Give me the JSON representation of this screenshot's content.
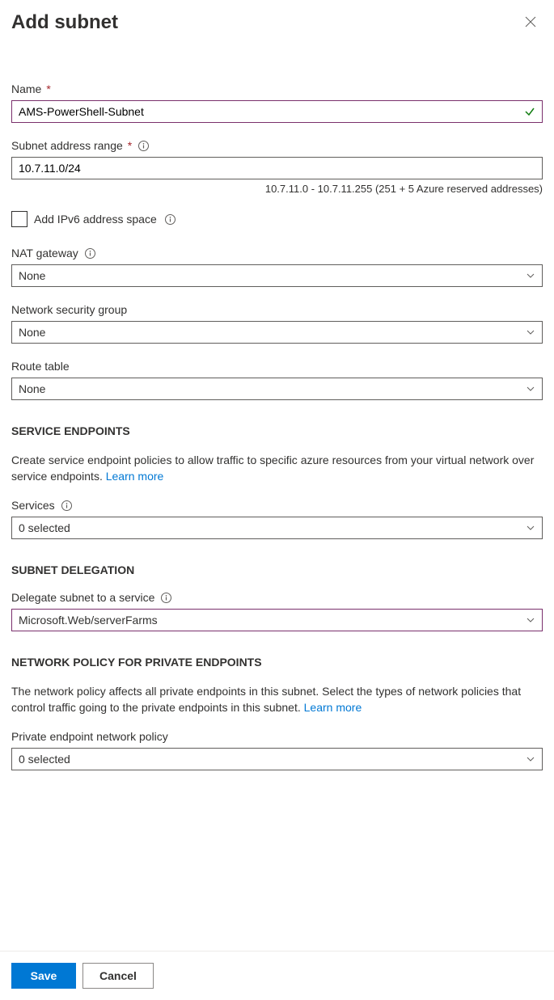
{
  "header": {
    "title": "Add subnet"
  },
  "name": {
    "label": "Name",
    "value": "AMS-PowerShell-Subnet"
  },
  "subnetRange": {
    "label": "Subnet address range",
    "value": "10.7.11.0/24",
    "hint": "10.7.11.0 - 10.7.11.255 (251 + 5 Azure reserved addresses)"
  },
  "ipv6": {
    "label": "Add IPv6 address space"
  },
  "natGateway": {
    "label": "NAT gateway",
    "value": "None"
  },
  "nsg": {
    "label": "Network security group",
    "value": "None"
  },
  "routeTable": {
    "label": "Route table",
    "value": "None"
  },
  "serviceEndpoints": {
    "header": "SERVICE ENDPOINTS",
    "description": "Create service endpoint policies to allow traffic to specific azure resources from your virtual network over service endpoints. ",
    "learnMore": "Learn more",
    "servicesLabel": "Services",
    "servicesValue": "0 selected"
  },
  "subnetDelegation": {
    "header": "SUBNET DELEGATION",
    "label": "Delegate subnet to a service",
    "value": "Microsoft.Web/serverFarms"
  },
  "networkPolicy": {
    "header": "NETWORK POLICY FOR PRIVATE ENDPOINTS",
    "description": "The network policy affects all private endpoints in this subnet. Select the types of network policies that control traffic going to the private endpoints in this subnet. ",
    "learnMore": "Learn more",
    "label": "Private endpoint network policy",
    "value": "0 selected"
  },
  "footer": {
    "save": "Save",
    "cancel": "Cancel"
  }
}
